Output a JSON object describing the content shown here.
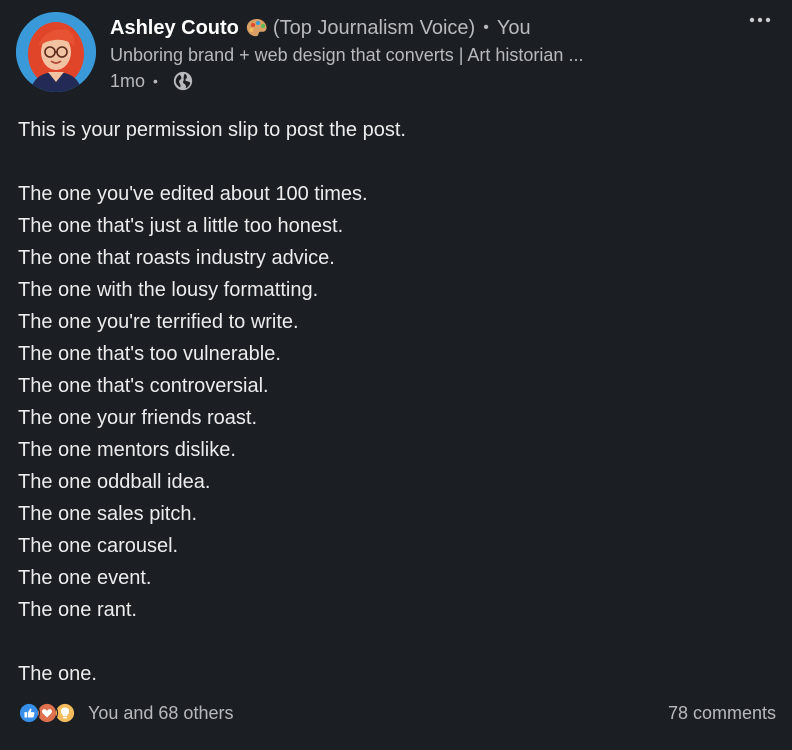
{
  "author": {
    "name": "Ashley Couto",
    "badge_icon": "artist-palette-icon",
    "voice_label": "(Top Journalism Voice)",
    "relation": "You",
    "headline": "Unboring brand + web design that converts | Art historian ...",
    "time": "1mo",
    "visibility_icon": "globe-icon"
  },
  "more_icon": "ellipsis-icon",
  "post": {
    "lines": [
      "This is your permission slip to post the post.",
      "",
      "The one you've edited about 100 times.",
      "The one that's just a little too honest.",
      "The one that roasts industry advice.",
      "The one with the lousy formatting.",
      "The one you're terrified to write.",
      "The one that's too vulnerable.",
      "The one that's controversial.",
      "The one your friends roast.",
      "The one mentors dislike.",
      "The one oddball idea.",
      "The one sales pitch.",
      "The one carousel.",
      "The one event.",
      "The one rant.",
      "",
      "The one."
    ]
  },
  "footer": {
    "reaction_icons": [
      "like-icon",
      "love-icon",
      "insightful-icon"
    ],
    "reactions_text": "You and 68 others",
    "comments_text": "78 comments"
  },
  "colors": {
    "background": "#1b1f23",
    "text_primary": "#ececed",
    "text_secondary": "#b7b9bc",
    "like": "#378fe9",
    "love": "#df704d",
    "insightful": "#f5bb5c"
  }
}
